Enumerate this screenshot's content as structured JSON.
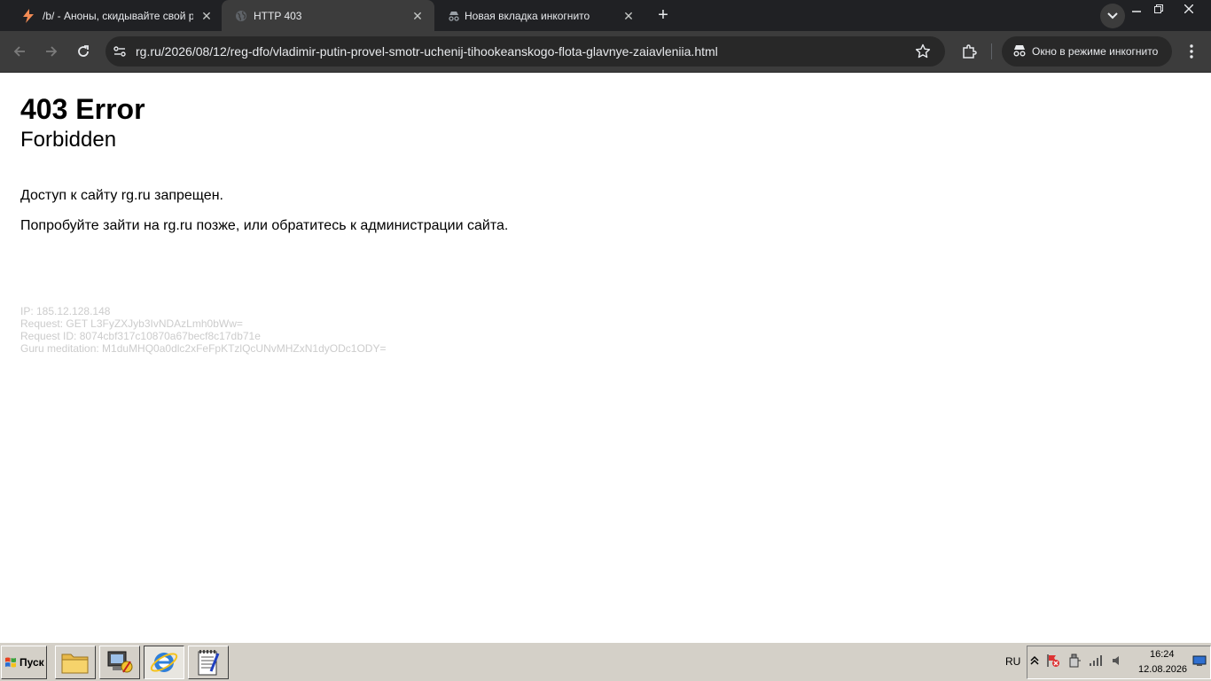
{
  "browser": {
    "tabs": [
      {
        "title": "/b/ - Аноны, скидывайте свой раб",
        "favicon": "lightning-icon",
        "active": false
      },
      {
        "title": "HTTP 403",
        "favicon": "globe-icon",
        "active": true
      },
      {
        "title": "Новая вкладка инкогнито",
        "favicon": "incognito-icon",
        "active": false
      }
    ],
    "url": "rg.ru/2026/08/12/reg-dfo/vladimir-putin-provel-smotr-uchenij-tihookeanskogo-flota-glavnye-zaiavleniia.html",
    "incognito_label": "Окно в режиме инкогнито",
    "accent_color": "#202124"
  },
  "page": {
    "title": "403 Error",
    "subtitle": "Forbidden",
    "message": "Доступ к сайту rg.ru запрещен.",
    "hint": "Попробуйте зайти на rg.ru позже, или обратитесь к администрации сайта.",
    "meta": {
      "ip": "IP: 185.12.128.148",
      "request": "Request: GET L3FyZXJyb3IvNDAzLmh0bWw=",
      "request_id": "Request ID: 8074cbf317c10870a67becf8c17db71e",
      "guru": "Guru meditation: M1duMHQ0a0dlc2xFeFpKTzlQcUNvMHZxN1dyODc1ODY="
    }
  },
  "taskbar": {
    "start_label": "Пуск",
    "apps": [
      "folder-icon",
      "control-panel-icon",
      "internet-explorer-icon",
      "notepad-icon"
    ],
    "language": "RU",
    "time": "16:24",
    "date": "12.08.2026"
  }
}
